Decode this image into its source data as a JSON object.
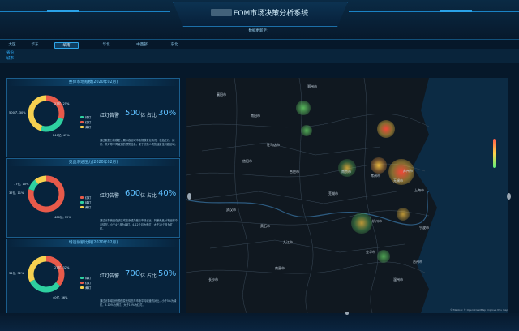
{
  "header": {
    "title": "EOM市场决策分析系统",
    "date_label": "数据更新至："
  },
  "tabs": [
    {
      "label": "大区",
      "active": false
    },
    {
      "label": "华东",
      "active": false
    },
    {
      "label": "华南",
      "active": true
    },
    {
      "label": "华北",
      "active": false
    },
    {
      "label": "中西部",
      "active": false
    },
    {
      "label": "东北",
      "active": false
    }
  ],
  "subnav": {
    "row1": "省份",
    "row2": "城市"
  },
  "panels": [
    {
      "title": "整体市场规模(2020年02月)",
      "metric_label": "红灯告警",
      "metric_count": "500",
      "metric_unit": "亿 占比",
      "metric_percent": "30%",
      "slices": [
        {
          "label": "红灯",
          "value": 30,
          "text": "500亿, 30%",
          "color": "#e85a4a"
        },
        {
          "label": "绿灯",
          "value": 25,
          "text": "27亿, 25%",
          "color": "#2ed0a0"
        },
        {
          "label": "黄灯",
          "value": 45,
          "text": "240亿, 45%",
          "color": "#f5d050"
        }
      ],
      "description": "通过数据分析模型，展示各区域市场规模变化情况，包括红灯、绿灯、黄灯等不同级别的预警信息，便于决策人员快速定位问题区域。"
    },
    {
      "title": "竞品渗透压力(2020年02月)",
      "metric_label": "红灯告警",
      "metric_count": "600",
      "metric_unit": "亿 占比",
      "metric_percent": "40%",
      "slices": [
        {
          "label": "红灯",
          "value": 79,
          "text": "400亿, 79%",
          "color": "#e85a4a"
        },
        {
          "label": "绿灯",
          "value": 10,
          "text": "17亿, 10%",
          "color": "#2ed0a0"
        },
        {
          "label": "黄灯",
          "value": 11,
          "text": "37亿, 11%",
          "color": "#f5d050"
        }
      ],
      "description": "通过计算竞品在该区域的渗透力度与市场占比，判断竞品对本品的冲击情况，小于4个月为绿灯，4-12个月为黄灯，大于12个月为红灯。"
    },
    {
      "title": "增速份额比例(2020年02月)",
      "metric_label": "红灯告警",
      "metric_count": "700",
      "metric_unit": "亿 占比",
      "metric_percent": "50%",
      "slices": [
        {
          "label": "红灯",
          "value": 36,
          "text": "40亿, 36%",
          "color": "#e85a4a"
        },
        {
          "label": "绿灯",
          "value": 32,
          "text": "34亿, 32%",
          "color": "#2ed0a0"
        },
        {
          "label": "黄灯",
          "value": 32,
          "text": "27亿, 32%",
          "color": "#f5d050"
        }
      ],
      "description": "通过计算增速份额的变化情况与市场平均增速的对比，小于5%为绿灯，5-10%为黄灯，大于10%为红灯。"
    }
  ],
  "map": {
    "cities": [
      "襄阳市",
      "郑州市",
      "南阳市",
      "驻马店市",
      "信阳市",
      "合肥市",
      "南京市",
      "常州市",
      "无锡市",
      "苏州市",
      "上海市",
      "杭州市",
      "宁波市",
      "武汉市",
      "黄石市",
      "九江市",
      "南昌市",
      "长沙市",
      "芜湖市",
      "金华市",
      "温州市",
      "台州市"
    ],
    "attribution": "© Mapbox © OpenStreetMap Improve this map",
    "heat_colors": {
      "high": "#ff4a3a",
      "mid": "#f5c040",
      "low": "#6ae06a"
    }
  }
}
